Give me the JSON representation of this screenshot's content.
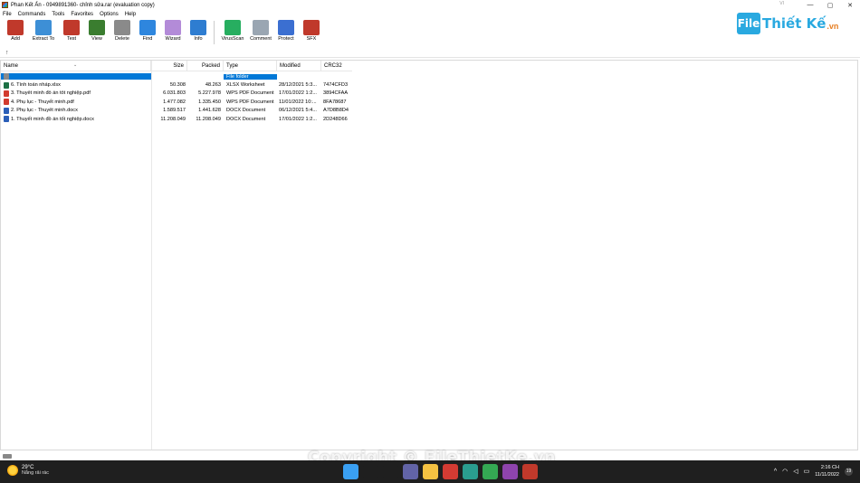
{
  "window": {
    "title": "Phan Kết Ấn - 0949891360- chỉnh sửa.rar (evaluation copy)",
    "lang_tag": "VI",
    "minimize": "—",
    "restore": "▢",
    "close": "✕"
  },
  "menu": [
    "File",
    "Commands",
    "Tools",
    "Favorites",
    "Options",
    "Help"
  ],
  "toolbar": [
    {
      "label": "Add",
      "icon": "add-icon",
      "color": "#c0392b"
    },
    {
      "label": "Extract To",
      "icon": "extract-folder-icon",
      "color": "#3d8fd6"
    },
    {
      "label": "Test",
      "icon": "test-book-icon",
      "color": "#c0392b"
    },
    {
      "label": "View",
      "icon": "view-book-icon",
      "color": "#3a7d2f"
    },
    {
      "label": "Delete",
      "icon": "trash-icon",
      "color": "#8a8a8a"
    },
    {
      "label": "Find",
      "icon": "magnifier-icon",
      "color": "#2e86de"
    },
    {
      "label": "Wizard",
      "icon": "wand-icon",
      "color": "#b38bd8"
    },
    {
      "label": "Info",
      "icon": "info-icon",
      "color": "#2e7dd1"
    },
    {
      "label": "VirusScan",
      "icon": "virus-scan-icon",
      "color": "#27ae60"
    },
    {
      "label": "Comment",
      "icon": "comment-icon",
      "color": "#9aa6b2"
    },
    {
      "label": "Protect",
      "icon": "shield-icon",
      "color": "#3b6fd1"
    },
    {
      "label": "SFX",
      "icon": "sfx-archive-icon",
      "color": "#c0392b"
    }
  ],
  "logo": {
    "box": "File",
    "text": "Thiết Kế",
    "domain": ".vn"
  },
  "path": {
    "up_icon": "↑"
  },
  "columns": {
    "name": "Name",
    "size": "Size",
    "packed": "Packed",
    "type": "Type",
    "modified": "Modified",
    "crc": "CRC32"
  },
  "sort_caret": "⌄",
  "files": [
    {
      "name": "",
      "size": "",
      "packed": "",
      "type": "File folder",
      "modified": "",
      "crc": "",
      "icon": "folder-icon",
      "icolor": "#8a8a8a",
      "selected": true
    },
    {
      "name": "6. Tính toán nháp.xlsx",
      "size": "50.308",
      "packed": "48.263",
      "type": "XLSX Worksheet",
      "modified": "28/12/2021 5:3...",
      "crc": "7474CFD3",
      "icon": "excel-file-icon",
      "icolor": "#1d7044"
    },
    {
      "name": "3. Thuyết minh đồ án tốt nghiệp.pdf",
      "size": "6.031.803",
      "packed": "5.227.978",
      "type": "WPS PDF Document",
      "modified": "17/01/2022 1:2...",
      "crc": "3894CFAA",
      "icon": "pdf-file-icon",
      "icolor": "#d23b2e"
    },
    {
      "name": "4. Phụ lục - Thuyết minh.pdf",
      "size": "1.477.082",
      "packed": "1.335.450",
      "type": "WPS PDF Document",
      "modified": "11/01/2022 10:...",
      "crc": "8FA78687",
      "icon": "pdf-file-icon",
      "icolor": "#d23b2e"
    },
    {
      "name": "2. Phụ lục - Thuyết minh.docx",
      "size": "1.589.517",
      "packed": "1.441.628",
      "type": "DOCX Document",
      "modified": "06/12/2021 5:4...",
      "crc": "A7D8B8D4",
      "icon": "word-file-icon",
      "icolor": "#2b5fb8"
    },
    {
      "name": "1. Thuyết minh đồ án tốt nghiệp.docx",
      "size": "11.208.049",
      "packed": "11.208.049",
      "type": "DOCX Document",
      "modified": "17/01/2022 1:2...",
      "crc": "2D248D66",
      "icon": "word-file-icon",
      "icolor": "#2b5fb8"
    }
  ],
  "watermark": "Copyright © FileThietKe.vn",
  "taskbar": {
    "temp": "29°C",
    "weather": "Nắng rải rác",
    "apps": [
      {
        "icon": "windows-start-icon",
        "color": "#3aa0f3"
      },
      {
        "icon": "search-icon",
        "color": "#1f1f1f"
      },
      {
        "icon": "task-view-icon",
        "color": "#1f1f1f"
      },
      {
        "icon": "teams-chat-icon",
        "color": "#6264a7"
      },
      {
        "icon": "file-explorer-icon",
        "color": "#f5c242"
      },
      {
        "icon": "wps-office-icon",
        "color": "#d43b33"
      },
      {
        "icon": "edge-browser-icon",
        "color": "#2a9d8f"
      },
      {
        "icon": "chrome-icon",
        "color": "#34a853"
      },
      {
        "icon": "winrar-icon",
        "color": "#8e44ad"
      },
      {
        "icon": "acrobat-icon",
        "color": "#c0392b"
      }
    ],
    "time": "2:16 CH",
    "date": "11/11/2022",
    "notif": "19"
  }
}
